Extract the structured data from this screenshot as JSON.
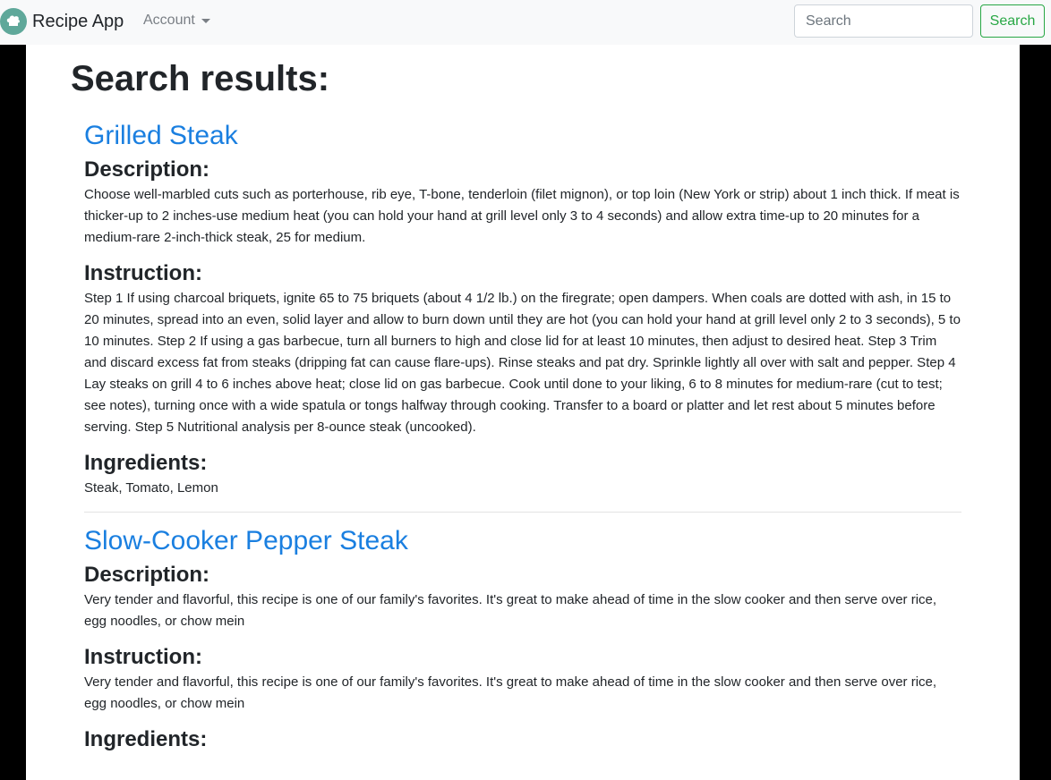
{
  "nav": {
    "brand": "Recipe App",
    "account_label": "Account",
    "search_placeholder": "Search",
    "search_button": "Search"
  },
  "page": {
    "title": "Search results:"
  },
  "recipes": [
    {
      "title": "Grilled Steak",
      "description_heading": "Description:",
      "description": "Choose well-marbled cuts such as porterhouse, rib eye, T-bone, tenderloin (filet mignon), or top loin (New York or strip) about 1 inch thick. If meat is thicker-up to 2 inches-use medium heat (you can hold your hand at grill level only 3 to 4 seconds) and allow extra time-up to 20 minutes for a medium-rare 2-inch-thick steak, 25 for medium.",
      "instruction_heading": "Instruction:",
      "instruction": "Step 1 If using charcoal briquets, ignite 65 to 75 briquets (about 4 1/2 lb.) on the firegrate; open dampers. When coals are dotted with ash, in 15 to 20 minutes, spread into an even, solid layer and allow to burn down until they are hot (you can hold your hand at grill level only 2 to 3 seconds), 5 to 10 minutes. Step 2 If using a gas barbecue, turn all burners to high and close lid for at least 10 minutes, then adjust to desired heat. Step 3 Trim and discard excess fat from steaks (dripping fat can cause flare-ups). Rinse steaks and pat dry. Sprinkle lightly all over with salt and pepper. Step 4 Lay steaks on grill 4 to 6 inches above heat; close lid on gas barbecue. Cook until done to your liking, 6 to 8 minutes for medium-rare (cut to test; see notes), turning once with a wide spatula or tongs halfway through cooking. Transfer to a board or platter and let rest about 5 minutes before serving. Step 5 Nutritional analysis per 8-ounce steak (uncooked).",
      "ingredients_heading": "Ingredients:",
      "ingredients": "Steak, Tomato, Lemon"
    },
    {
      "title": "Slow-Cooker Pepper Steak",
      "description_heading": "Description:",
      "description": "Very tender and flavorful, this recipe is one of our family's favorites. It's great to make ahead of time in the slow cooker and then serve over rice, egg noodles, or chow mein",
      "instruction_heading": "Instruction:",
      "instruction": "Very tender and flavorful, this recipe is one of our family's favorites. It's great to make ahead of time in the slow cooker and then serve over rice, egg noodles, or chow mein",
      "ingredients_heading": "Ingredients:"
    }
  ],
  "icons": {
    "logo": "chef-hat-icon",
    "account_dropdown": "caret-down-icon"
  },
  "colors": {
    "link": "#1a7fe0",
    "success": "#28a745",
    "navbar_bg": "#f8f9fa",
    "logo_bg": "#5fa89a"
  }
}
